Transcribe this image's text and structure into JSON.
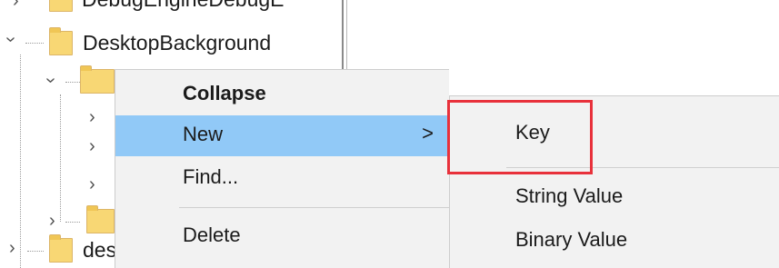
{
  "tree": {
    "cutoff_label": "DebugEngineDebugE",
    "items": [
      {
        "label": "DesktopBackground"
      },
      {
        "label": ""
      },
      {
        "label": "des"
      }
    ]
  },
  "context_menu": {
    "items": [
      {
        "label": "Collapse"
      },
      {
        "label": "New",
        "arrow": ">"
      },
      {
        "label": "Find..."
      },
      {
        "label": "Delete"
      }
    ]
  },
  "submenu": {
    "items": [
      {
        "label": "Key"
      },
      {
        "label": "String Value"
      },
      {
        "label": "Binary Value"
      }
    ]
  },
  "colors": {
    "highlight": "#91c9f7",
    "annotation_box": "#e8313b",
    "folder": "#f8d774"
  }
}
